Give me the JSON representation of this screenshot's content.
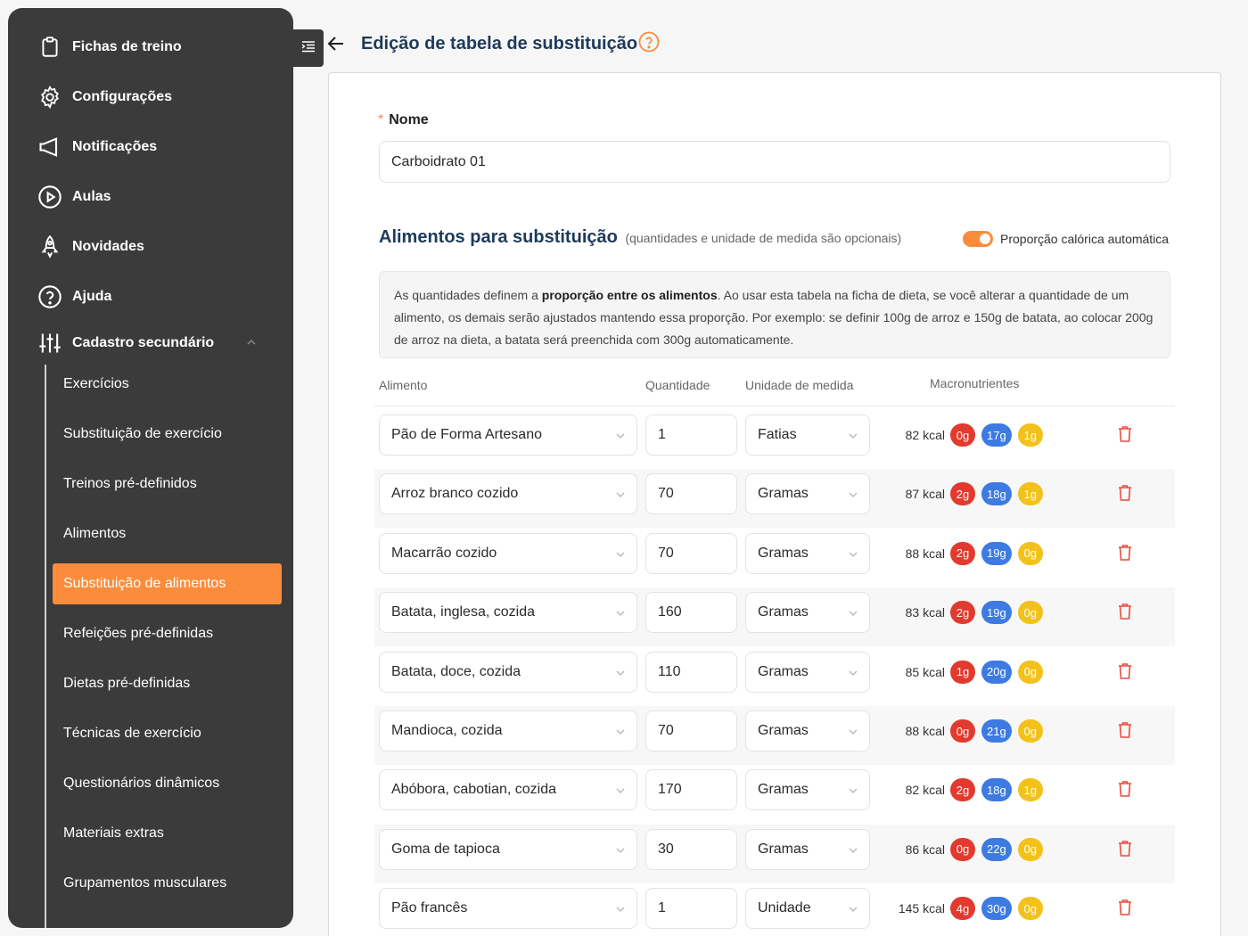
{
  "sidebar": {
    "items": [
      {
        "label": "Fichas de treino",
        "icon": "clipboard-icon"
      },
      {
        "label": "Configurações",
        "icon": "gear-icon"
      },
      {
        "label": "Notificações",
        "icon": "megaphone-icon"
      },
      {
        "label": "Aulas",
        "icon": "play-circle-icon"
      },
      {
        "label": "Novidades",
        "icon": "rocket-icon"
      },
      {
        "label": "Ajuda",
        "icon": "help-circle-icon"
      },
      {
        "label": "Cadastro secundário",
        "icon": "sliders-icon"
      }
    ],
    "subitems": [
      {
        "label": "Exercícios"
      },
      {
        "label": "Substituição de exercício"
      },
      {
        "label": "Treinos pré-definidos"
      },
      {
        "label": "Alimentos"
      },
      {
        "label": "Substituição de alimentos",
        "active": true
      },
      {
        "label": "Refeições pré-definidas"
      },
      {
        "label": "Dietas pré-definidas"
      },
      {
        "label": "Técnicas de exercício"
      },
      {
        "label": "Questionários dinâmicos"
      },
      {
        "label": "Materiais extras"
      },
      {
        "label": "Grupamentos musculares"
      }
    ]
  },
  "header": {
    "title": "Edição de tabela de substituição"
  },
  "form": {
    "name_label": "Nome",
    "name_required_mark": "*",
    "name_value": "Carboidrato 01",
    "section_title": "Alimentos para substituição",
    "section_hint": "(quantidades e unidade de medida são opcionais)",
    "toggle_label": "Proporção calórica automática",
    "toggle_on": true,
    "info_part1": "As quantidades definem a ",
    "info_bold": "proporção entre os alimentos",
    "info_part2": ". Ao usar esta tabela na ficha de dieta, se você alterar a quantidade de um alimento, os demais serão ajustados mantendo essa proporção. Por exemplo: se definir 100g de arroz e 150g de batata, ao colocar 200g de arroz na dieta, a batata será preenchida com 300g automaticamente."
  },
  "table": {
    "columns": {
      "food": "Alimento",
      "qty": "Quantidade",
      "unit": "Unidade de medida",
      "macros": "Macronutrientes"
    },
    "rows": [
      {
        "food": "Pão de Forma Artesano",
        "qty": "1",
        "unit": "Fatias",
        "kcal": "82 kcal",
        "p": "0g",
        "c": "17g",
        "f": "1g"
      },
      {
        "food": "Arroz branco cozido",
        "qty": "70",
        "unit": "Gramas",
        "kcal": "87 kcal",
        "p": "2g",
        "c": "18g",
        "f": "1g"
      },
      {
        "food": "Macarrão cozido",
        "qty": "70",
        "unit": "Gramas",
        "kcal": "88 kcal",
        "p": "2g",
        "c": "19g",
        "f": "0g"
      },
      {
        "food": "Batata, inglesa, cozida",
        "qty": "160",
        "unit": "Gramas",
        "kcal": "83 kcal",
        "p": "2g",
        "c": "19g",
        "f": "0g"
      },
      {
        "food": "Batata, doce, cozida",
        "qty": "110",
        "unit": "Gramas",
        "kcal": "85 kcal",
        "p": "1g",
        "c": "20g",
        "f": "0g"
      },
      {
        "food": "Mandioca, cozida",
        "qty": "70",
        "unit": "Gramas",
        "kcal": "88 kcal",
        "p": "0g",
        "c": "21g",
        "f": "0g"
      },
      {
        "food": "Abóbora, cabotian, cozida",
        "qty": "170",
        "unit": "Gramas",
        "kcal": "82 kcal",
        "p": "2g",
        "c": "18g",
        "f": "1g"
      },
      {
        "food": "Goma de tapioca",
        "qty": "30",
        "unit": "Gramas",
        "kcal": "86 kcal",
        "p": "0g",
        "c": "22g",
        "f": "0g"
      },
      {
        "food": "Pão francês",
        "qty": "1",
        "unit": "Unidade",
        "kcal": "145 kcal",
        "p": "4g",
        "c": "30g",
        "f": "0g"
      }
    ]
  },
  "colors": {
    "accent": "#fb8c3c",
    "sidebar_bg": "#3b3b3b",
    "title": "#1e3a5a",
    "protein": "#e23a2e",
    "carb": "#3d7be2",
    "fat": "#f3c21a"
  }
}
